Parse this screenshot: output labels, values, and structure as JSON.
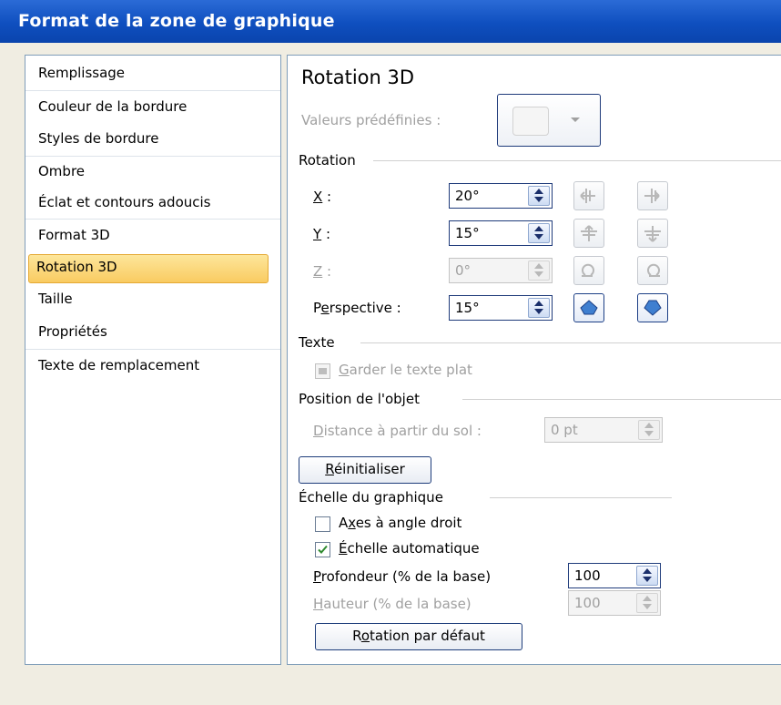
{
  "window": {
    "title": "Format de la zone de graphique"
  },
  "nav": {
    "items": [
      "Remplissage",
      "Couleur de la bordure",
      "Styles de bordure",
      "Ombre",
      "Éclat et contours adoucis",
      "Format 3D",
      "Rotation 3D",
      "Taille",
      "Propriétés",
      "Texte de remplacement"
    ],
    "selected": "Rotation 3D"
  },
  "panel": {
    "heading": "Rotation 3D",
    "presets_label": "Valeurs prédéfinies :",
    "rotation": {
      "group": "Rotation",
      "x_label": "X :",
      "x_value": "20°",
      "y_label": "Y :",
      "y_value": "15°",
      "z_label": "Z :",
      "z_value": "0°",
      "perspective_label": "Perspective :",
      "perspective_value": "15°"
    },
    "text": {
      "group": "Texte",
      "keep_flat_label": "Garder le texte plat"
    },
    "object_position": {
      "group": "Position de l'objet",
      "distance_label": "Distance à partir du sol :",
      "distance_value": "0 pt"
    },
    "reset_label": "Réinitialiser",
    "chart_scale": {
      "group": "Échelle du graphique",
      "right_angle_axes_label": "Axes à angle droit",
      "right_angle_axes_checked": false,
      "auto_scale_label": "Échelle automatique",
      "auto_scale_checked": true,
      "depth_label": "Profondeur (% de la base)",
      "depth_value": "100",
      "height_label": "Hauteur (% de la base)",
      "height_value": "100"
    },
    "default_rotation_label": "Rotation par défaut"
  },
  "colors": {
    "titlebar": "#0f4fbf",
    "selection": "#f9cb61",
    "border_dark": "#1e3a7a"
  }
}
